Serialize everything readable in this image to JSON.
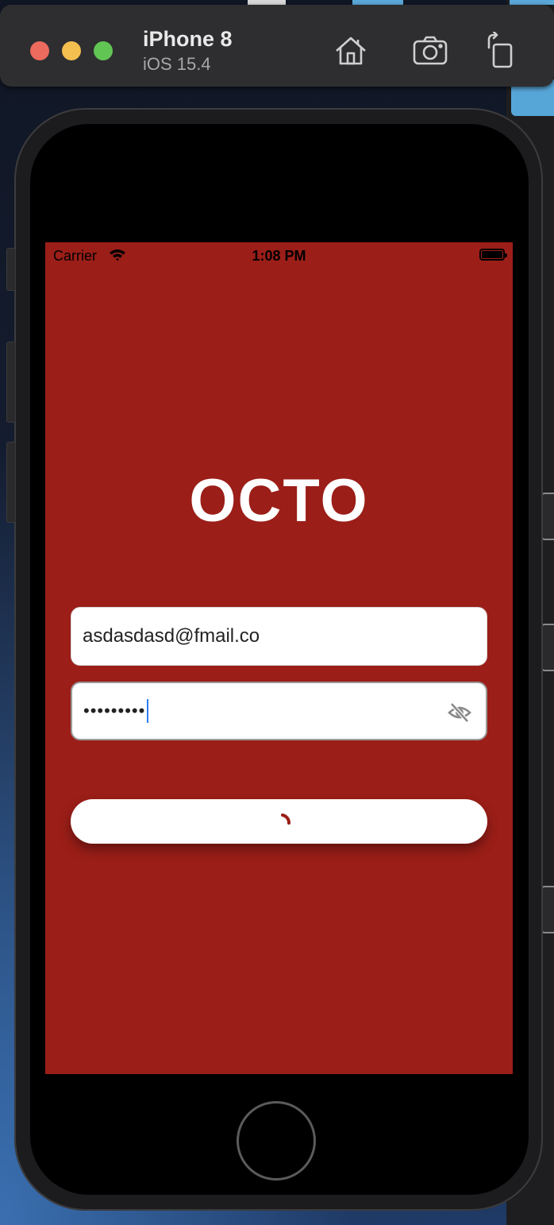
{
  "simulator": {
    "device_name": "iPhone 8",
    "os_version": "iOS 15.4",
    "toolbar_icons": [
      "home-icon",
      "screenshot-icon",
      "rotate-icon"
    ]
  },
  "status_bar": {
    "carrier": "Carrier",
    "time": "1:08 PM"
  },
  "app": {
    "logo": "OCTO",
    "email_value": "asdasdasd@fmail.co",
    "password_mask": "•••••••••",
    "password_toggle_icon": "eye-off-icon",
    "login_state_icon": "spinner-icon"
  },
  "colors": {
    "app_background": "#9b1e18",
    "accent_caret": "#2f7cf6"
  }
}
